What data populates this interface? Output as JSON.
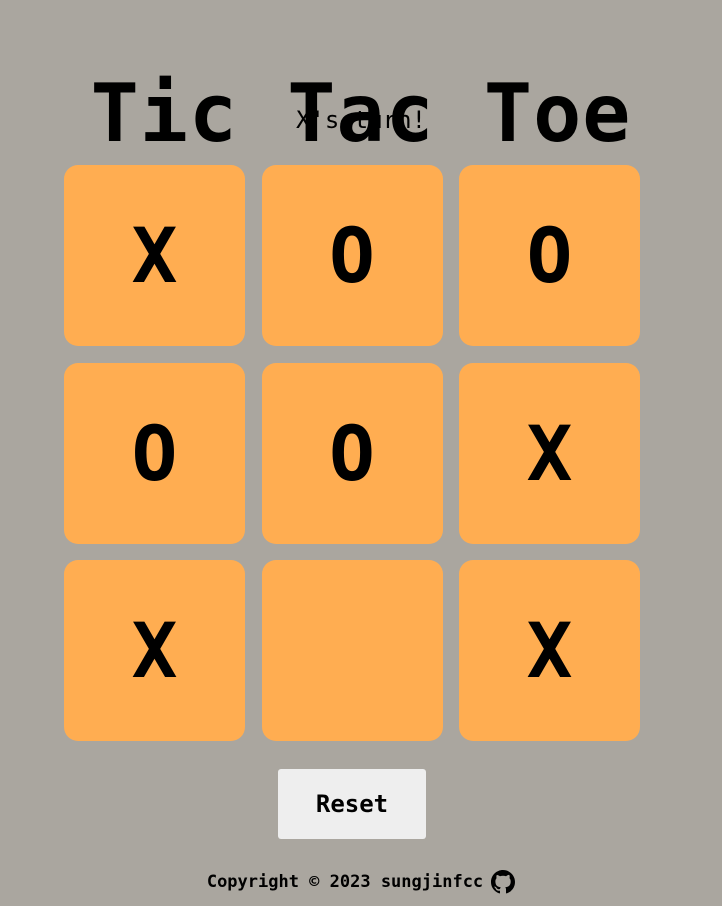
{
  "header": {
    "title": "Tic Tac Toe",
    "status": "X's turn!"
  },
  "board": {
    "cells": [
      "X",
      "O",
      "O",
      "O",
      "O",
      "X",
      "X",
      "",
      "X"
    ]
  },
  "controls": {
    "reset_label": "Reset"
  },
  "footer": {
    "copyright": "Copyright © 2023 sungjinfcc",
    "github_icon": "github-icon"
  },
  "colors": {
    "background": "#aaa69f",
    "cell": "#ffad51",
    "button": "#eeeeee",
    "text": "#000000"
  }
}
